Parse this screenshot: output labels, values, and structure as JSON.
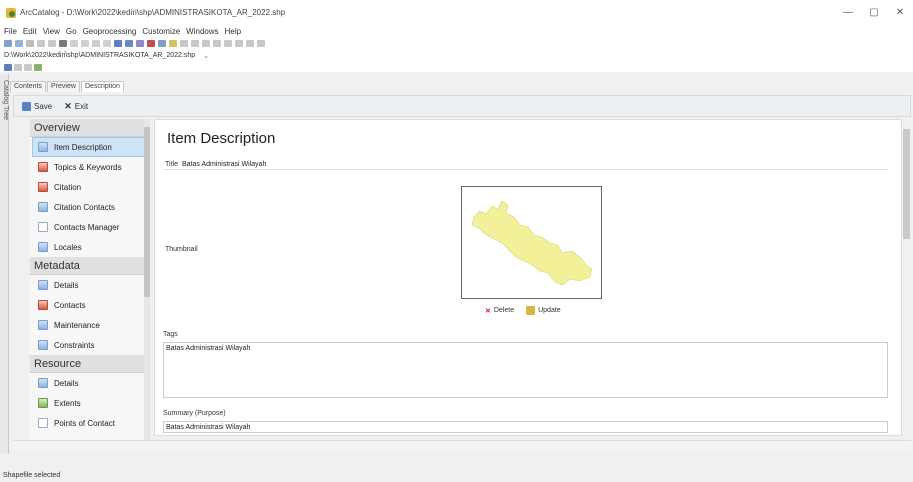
{
  "window": {
    "title": "ArcCatalog - D:\\Work\\2022\\kediri\\shp\\ADMINISTRASIKOTA_AR_2022.shp",
    "minimize": "—",
    "maximize": "▢",
    "close": "✕"
  },
  "menu": [
    "File",
    "Edit",
    "View",
    "Go",
    "Geoprocessing",
    "Customize",
    "Windows",
    "Help"
  ],
  "location": {
    "path": "D:\\Work\\2022\\kediri\\shp\\ADMINISTRASIKOTA_AR_2022.shp",
    "arrow": "⌄"
  },
  "side_tab": "Catalog Tree",
  "tabs": [
    "Contents",
    "Preview",
    "Description"
  ],
  "actions": {
    "save": "Save",
    "exit": "Exit"
  },
  "nav": {
    "sections": [
      {
        "title": "Overview",
        "items": [
          "Item Description",
          "Topics & Keywords",
          "Citation",
          "Citation Contacts",
          "Contacts Manager",
          "Locales"
        ]
      },
      {
        "title": "Metadata",
        "items": [
          "Details",
          "Contacts",
          "Maintenance",
          "Constraints"
        ]
      },
      {
        "title": "Resource",
        "items": [
          "Details",
          "Extents",
          "Points of Contact"
        ]
      }
    ]
  },
  "content": {
    "heading": "Item Description",
    "title_label": "Title",
    "title_value": "Batas Administrasi Wilayah",
    "thumbnail_label": "Thumbnail",
    "delete_label": "Delete",
    "update_label": "Update",
    "tags_label": "Tags",
    "tags_value": "Batas Administrasi Wilayah",
    "summary_label": "Summary (Purpose)",
    "summary_value": "Batas Administrasi Wilayah"
  },
  "status": "Shapefile selected",
  "colors": {
    "map_fill": "#f3f09a",
    "selected_item": "#cfe3f7"
  }
}
